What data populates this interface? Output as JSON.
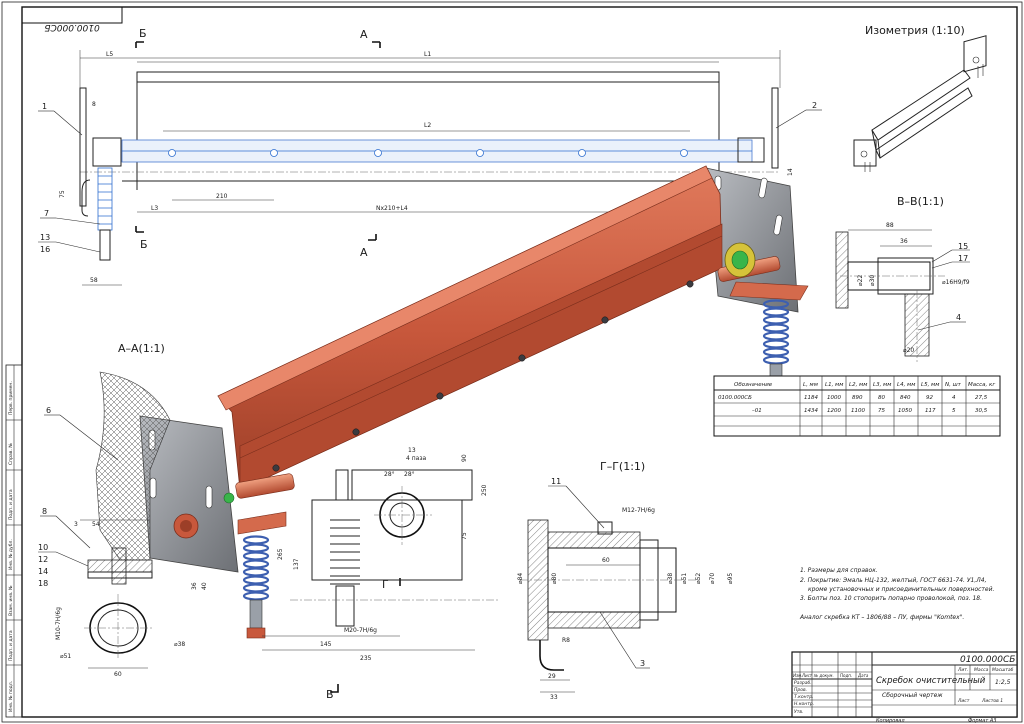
{
  "doc_number_corner": "0100.000СБ",
  "section_marks": {
    "b": "Б",
    "a": "А",
    "g": "Г",
    "v": "В"
  },
  "views": {
    "isometry": "Изометрия (1:10)",
    "section_aa": "А–А(1:1)",
    "section_vv": "В–В(1:1)",
    "section_gg": "Г–Г(1:1)"
  },
  "front_dims": {
    "L5": "L5",
    "L1": "L1",
    "L2": "L2",
    "L3": "L3",
    "d210": "210",
    "nl4": "Nx210+L4",
    "d8": "8",
    "d75": "75",
    "d58": "58",
    "d14": "14"
  },
  "callouts": {
    "c1": "1",
    "c2": "2",
    "c7": "7",
    "c13": "13",
    "c16": "16",
    "c6": "6",
    "c8": "8",
    "c10": "10",
    "c12": "12",
    "c14": "14",
    "c18": "18",
    "c15": "15",
    "c17": "17",
    "c4": "4",
    "c11": "11",
    "c3": "3"
  },
  "dims_vv": {
    "d88": "88",
    "d36": "36",
    "d22": "⌀22",
    "d30": "⌀30",
    "fit": "⌀16H9/f9",
    "d20": "⌀20"
  },
  "dims_aa": {
    "d3": "3",
    "d54": "54",
    "d36": "36",
    "d40": "40",
    "thread": "M10-7H/6g",
    "d51": "⌀51",
    "d38": "⌀38",
    "d60": "60"
  },
  "dims_center": {
    "d13": "13",
    "d4": "4 паза",
    "d28a": "28°",
    "d28b": "28°",
    "d90": "90",
    "d250": "250",
    "d75": "75",
    "d265": "265",
    "d137": "137",
    "thread": "M20-7H/6g",
    "d145": "145",
    "d235": "235"
  },
  "dims_gg": {
    "thread": "M12-7H/6g",
    "d60": "60",
    "d84": "⌀84",
    "d80": "⌀80",
    "d38": "⌀38",
    "d51": "⌀51",
    "d52": "⌀52",
    "d70": "⌀70",
    "d95": "⌀95",
    "r8": "R8",
    "d29": "29",
    "d33": "33"
  },
  "table": {
    "headers": [
      "Обозначение",
      "L, мм",
      "L1, мм",
      "L2, мм",
      "L3, мм",
      "L4, мм",
      "L5, мм",
      "N, шт",
      "Масса, кг"
    ],
    "rows": [
      [
        "0100.000СБ",
        "1184",
        "1000",
        "890",
        "80",
        "840",
        "92",
        "4",
        "27,5"
      ],
      [
        "–01",
        "1434",
        "1200",
        "1100",
        "75",
        "1050",
        "117",
        "5",
        "30,5"
      ]
    ]
  },
  "notes": [
    "1. Размеры для справок.",
    "2. Покрытие: Эмаль НЦ-132, желтый, ГОСТ 6631-74. У1,Л4,",
    "кроме установочных и присоединительных поверхностей.",
    "3. Болты поз. 10 стопорить попарно проволокой, поз. 18.",
    "Аналог скребка КТ – 1806/88 – ПУ, фирмы \"Komtex\"."
  ],
  "title_block": {
    "designation": "0100.000СБ",
    "name": "Скребок очистительный",
    "subtitle": "Сборочный чертеж",
    "lit_hdr": "Лит.",
    "mass_hdr": "Масса",
    "scale_hdr": "Масштаб",
    "scale": "1:2,5",
    "sheet": "Лист",
    "sheets": "Листов 1",
    "roles": [
      "Разраб.",
      "Пров.",
      "Т.контр.",
      "Н.контр.",
      "Утв."
    ],
    "cols": [
      "Изм.",
      "Лист",
      "№ докум.",
      "Подп.",
      "Дата"
    ],
    "copied": "Копировал",
    "format": "Формат  А3"
  },
  "side_stamp": [
    "Перв. примен.",
    "Справ. №",
    "Подп. и дата",
    "Инв. № дубл.",
    "Взам. инв. №",
    "Подп. и дата",
    "Инв. № подл."
  ],
  "colors": {
    "body": "#c8583c",
    "body_dark": "#9c3f28",
    "body_light": "#e07a5c",
    "plate": "#8a8d92",
    "spring": "#3d5fb0",
    "accent_yellow": "#d6c33a",
    "green_dot": "#39b54a"
  }
}
